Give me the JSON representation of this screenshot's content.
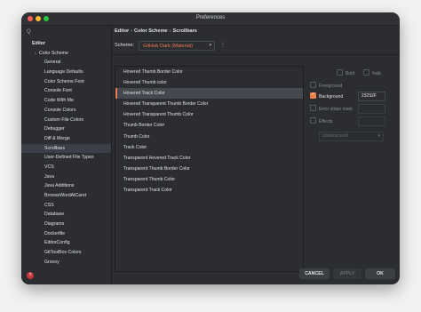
{
  "window": {
    "title": "Preferences"
  },
  "search": {
    "icon": "search-icon",
    "glyph": "Q"
  },
  "tree": [
    {
      "label": "Editor",
      "level": 0
    },
    {
      "label": "Color Scheme",
      "level": 1,
      "expanded": true
    },
    {
      "label": "General",
      "level": 2
    },
    {
      "label": "Language Defaults",
      "level": 2
    },
    {
      "label": "Color Scheme Font",
      "level": 2
    },
    {
      "label": "Console Font",
      "level": 2
    },
    {
      "label": "Code With Me",
      "level": 2
    },
    {
      "label": "Console Colors",
      "level": 2
    },
    {
      "label": "Custom File Colors",
      "level": 2
    },
    {
      "label": "Debugger",
      "level": 2
    },
    {
      "label": "Diff & Merge",
      "level": 2
    },
    {
      "label": "Scrollbars",
      "level": 2,
      "selected": true
    },
    {
      "label": "User-Defined File Types",
      "level": 2
    },
    {
      "label": "VCS",
      "level": 2
    },
    {
      "label": "Java",
      "level": 2
    },
    {
      "label": "Java Additions",
      "level": 2
    },
    {
      "label": "BrowseWordAtCaret",
      "level": 2
    },
    {
      "label": "CSS",
      "level": 2
    },
    {
      "label": "Database",
      "level": 2
    },
    {
      "label": "Diagrams",
      "level": 2
    },
    {
      "label": "Dockerfile",
      "level": 2
    },
    {
      "label": "EditorConfig",
      "level": 2
    },
    {
      "label": "GitToolBox Colors",
      "level": 2
    },
    {
      "label": "Groovy",
      "level": 2
    }
  ],
  "breadcrumb": {
    "part1": "Editor",
    "part2": "Color Scheme",
    "part3": "Scrollbars",
    "separator": "›"
  },
  "scheme": {
    "label": "Scheme:",
    "value": "GitHub Dark (Material)",
    "arrow": "▾",
    "more": "⋮"
  },
  "list": {
    "items": [
      "Hovered Thumb Border Color",
      "Hovered Thumb color",
      "Hovered Track Color",
      "Hovered Transparent Thumb Border Color",
      "Hovered Transparent Thumb Color",
      "Thumb Border Color",
      "Thumb Color",
      "Track Color",
      "Transparent Hovered Track Color",
      "Transparent Thumb Border Color",
      "Transparent Thumb Color",
      "Transparent Track Color"
    ],
    "selected_index": 2
  },
  "props": {
    "bold": "Bold",
    "italic": "Italic",
    "foreground": "Foreground",
    "background": "Background",
    "background_value": "23292F",
    "error_stripe": "Error stripe mark",
    "effects": "Effects",
    "effects_style": "Underscored"
  },
  "footer": {
    "help": "?",
    "cancel": "CANCEL",
    "apply": "APPLY",
    "ok": "OK"
  },
  "colors": {
    "accent": "#e8804b",
    "scheme_value": "#f07a54",
    "help": "#c9353d"
  }
}
